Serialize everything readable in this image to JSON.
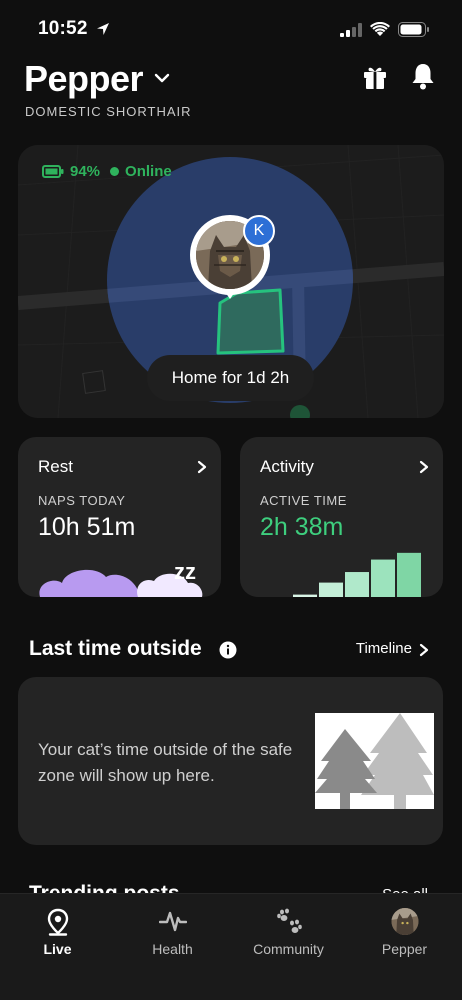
{
  "status_bar": {
    "time": "10:52"
  },
  "header": {
    "pet_name": "Pepper",
    "breed": "DOMESTIC SHORTHAIR"
  },
  "map_card": {
    "battery": "94%",
    "connection_status": "Online",
    "badge_initial": "K",
    "location_label": "Home",
    "location_duration": "for 1d 2h"
  },
  "rest_card": {
    "title": "Rest",
    "label": "NAPS TODAY",
    "value": "10h 51m",
    "sleep_glyph": "zz"
  },
  "activity_card": {
    "title": "Activity",
    "label": "ACTIVE TIME",
    "value": "2h 38m",
    "bar_levels": [
      0.05,
      0.3,
      0.52,
      0.78,
      0.92
    ]
  },
  "outside_section": {
    "title": "Last time outside",
    "link": "Timeline",
    "empty_message": "Your cat’s time outside of the safe zone will show up here."
  },
  "next_section": {
    "title": "Trending posts",
    "link": "See all"
  },
  "tab_bar": {
    "tabs": [
      {
        "label": "Live",
        "icon": "location-pin-icon",
        "active": true
      },
      {
        "label": "Health",
        "icon": "heartbeat-icon",
        "active": false
      },
      {
        "label": "Community",
        "icon": "paw-prints-icon",
        "active": false
      },
      {
        "label": "Pepper",
        "icon": "pet-avatar",
        "active": false
      }
    ]
  },
  "colors": {
    "accent_green": "#2fb35d",
    "badge_blue": "#2d6fd6",
    "safe_zone_blue": "#2a3f6e",
    "rest_purple": "#b89af0",
    "activity_green": "#7fd6a5"
  }
}
